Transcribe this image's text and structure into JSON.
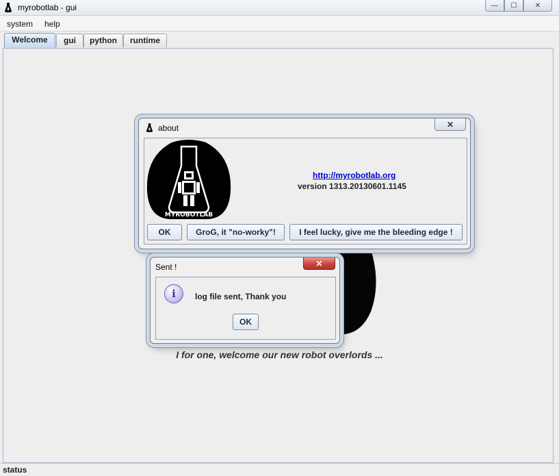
{
  "window": {
    "title": "myrobotlab - gui",
    "controls": {
      "minimize": "—",
      "maximize": "☐",
      "close": "✕"
    }
  },
  "menu": {
    "items": [
      "system",
      "help"
    ]
  },
  "tabs": [
    {
      "label": "Welcome",
      "active": true
    },
    {
      "label": "gui",
      "active": false
    },
    {
      "label": "python",
      "active": false
    },
    {
      "label": "runtime",
      "active": false
    }
  ],
  "welcome": {
    "tagline": "I for one, welcome our new robot overlords ..."
  },
  "about_dialog": {
    "title": "about",
    "link": "http://myrobotlab.org",
    "version": "version 1313.20130601.1145",
    "logo_text": "MYROBOTLAB",
    "buttons": {
      "ok": "OK",
      "no_worky": "GroG, it \"no-worky\"!",
      "lucky": "I feel lucky, give me the bleeding edge !"
    }
  },
  "sent_dialog": {
    "title": "Sent !",
    "message": "log file sent, Thank you",
    "ok": "OK",
    "icon": "info-icon"
  },
  "status": {
    "label": "status"
  },
  "colors": {
    "tab_active": "#c7d9f0",
    "link": "#0000cc",
    "close_red": "#c9463d",
    "info_icon": "#9c94d8"
  }
}
